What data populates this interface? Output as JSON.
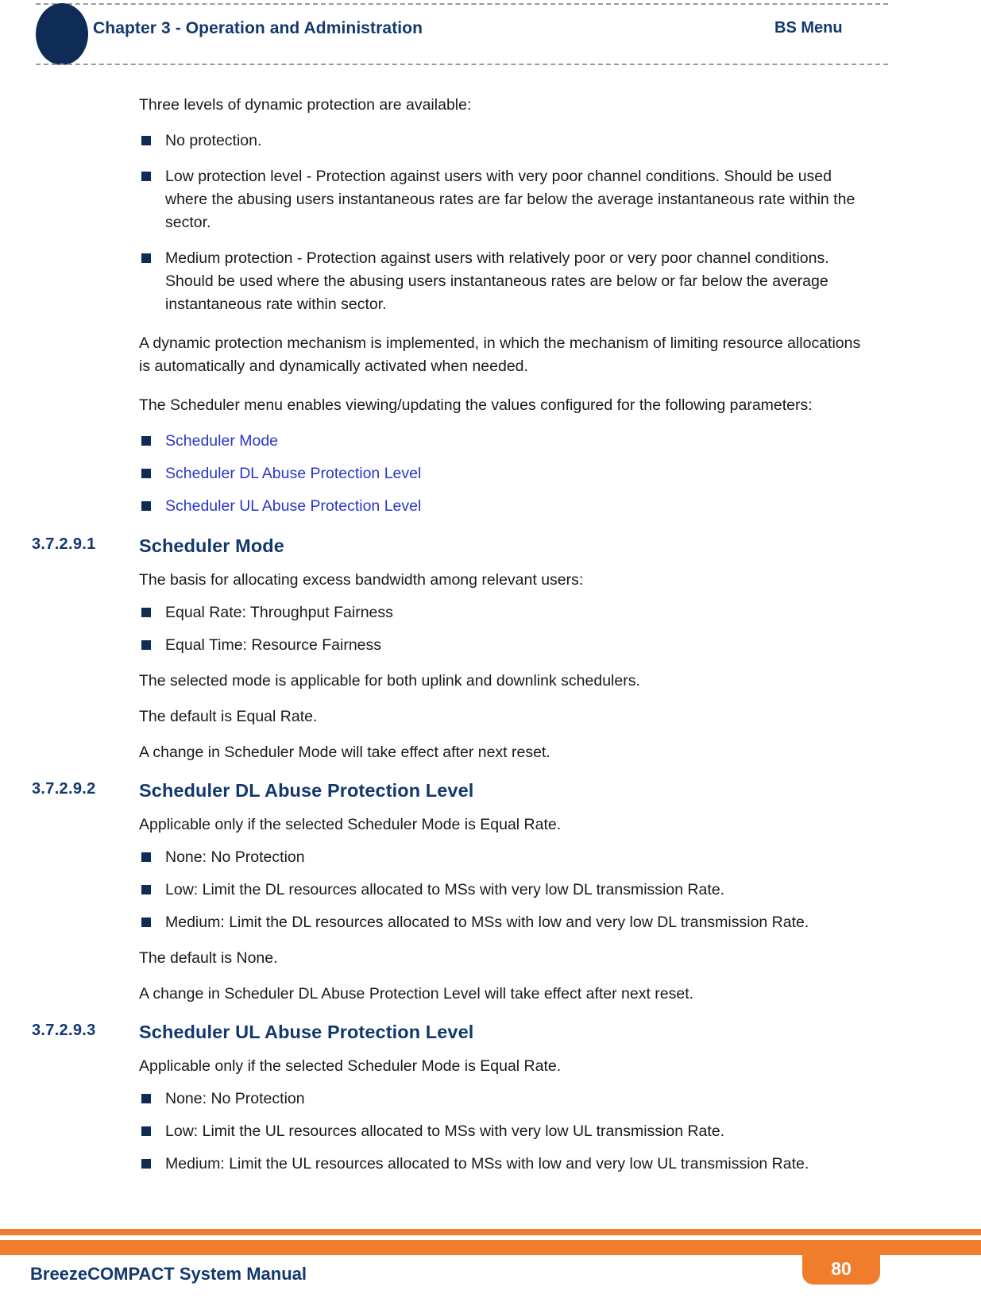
{
  "header": {
    "chapter_title": "Chapter 3 - Operation and Administration",
    "section_title": "BS Menu",
    "circle_color": "#0e2c56",
    "text_color": "#12386d"
  },
  "content": {
    "intro_paragraph": "Three levels of dynamic protection are available:",
    "protection_levels": [
      "No protection.",
      "Low protection level - Protection against users with very poor channel conditions. Should be used where the abusing users instantaneous rates are far below the average instantaneous rate within the sector.",
      "Medium protection - Protection against users with relatively poor or very poor channel conditions. Should be used where the abusing users instantaneous rates are below or far below the average instantaneous rate within sector."
    ],
    "mechanism_paragraph": "A dynamic protection mechanism is implemented, in which the mechanism of limiting resource allocations is automatically and dynamically activated when needed.",
    "scheduler_menu_paragraph": "The Scheduler menu enables viewing/updating the values configured for the following parameters:",
    "scheduler_links": [
      "Scheduler Mode",
      "Scheduler DL Abuse Protection Level",
      "Scheduler UL Abuse Protection Level"
    ],
    "link_color": "#2b35c8",
    "bullet_color": "#0e2c56"
  },
  "sections": [
    {
      "number": "3.7.2.9.1",
      "title": "Scheduler Mode",
      "intro": "The basis for allocating excess bandwidth among relevant users:",
      "bullets": [
        "Equal Rate: Throughput Fairness",
        "Equal Time: Resource Fairness"
      ],
      "notes": [
        "The selected mode is applicable for both uplink and downlink schedulers.",
        "The default is Equal Rate.",
        "A change in Scheduler Mode will take effect after next reset."
      ]
    },
    {
      "number": "3.7.2.9.2",
      "title": "Scheduler DL Abuse Protection Level",
      "intro": "Applicable only if the selected Scheduler Mode is Equal Rate.",
      "bullets": [
        "None: No Protection",
        "Low: Limit the DL resources allocated to MSs with very low DL transmission Rate.",
        "Medium: Limit the DL resources allocated to MSs with low and very low DL transmission Rate."
      ],
      "notes": [
        "The default is None.",
        "A change in Scheduler DL Abuse Protection Level will take effect after next reset."
      ]
    },
    {
      "number": "3.7.2.9.3",
      "title": "Scheduler UL Abuse Protection Level",
      "intro": "Applicable only if the selected Scheduler Mode is Equal Rate.",
      "bullets": [
        "None: No Protection",
        "Low: Limit the UL resources allocated to MSs with very low UL transmission Rate.",
        "Medium: Limit the UL resources allocated to MSs with low and very low UL transmission Rate."
      ],
      "notes": []
    }
  ],
  "footer": {
    "manual_title": "BreezeCOMPACT System Manual",
    "page_number": "80",
    "accent_color": "#f07d2b",
    "text_color": "#12386d"
  }
}
